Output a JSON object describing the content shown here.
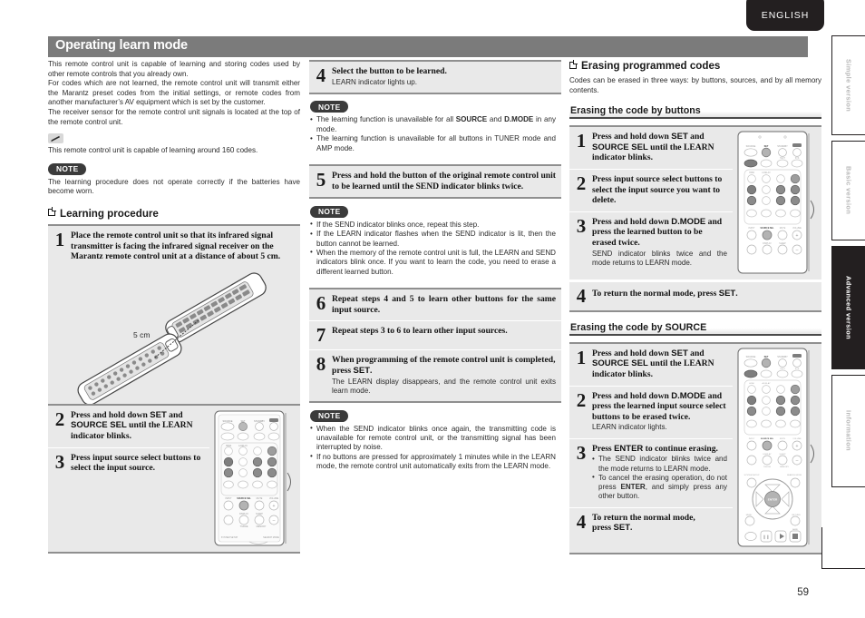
{
  "header": {
    "language_tab": "ENGLISH",
    "title": "Operating learn mode",
    "page_number": "59"
  },
  "side_tabs": [
    {
      "label": "Simple version",
      "active": false
    },
    {
      "label": "Basic version",
      "active": false
    },
    {
      "label": "Advanced version",
      "active": true
    },
    {
      "label": "Information",
      "active": false
    }
  ],
  "column1": {
    "intro_p1": "This remote control unit is capable of learning and storing codes used by other remote controls that you already own.",
    "intro_p2": "For codes which are not learned, the remote control unit will transmit either the Marantz preset codes from the initial settings, or remote codes from another manufacturer’s AV equipment which is set by the customer.",
    "intro_p3": "The receiver sensor for the remote control unit signals is located at the top of the remote control unit.",
    "tip_icon": "pencil-icon",
    "tip_text": "This remote control unit is capable of learning around 160 codes.",
    "note_label": "NOTE",
    "note_text": "The learning procedure does not operate correctly if the batteries have become worn.",
    "section_heading": "Learning procedure",
    "step1_num": "1",
    "step1_text": "Place the remote control unit so that its infrared signal transmitter is facing the infrared signal receiver on the Marantz remote control unit at a distance of about 5 cm.",
    "figure_label": "5 cm",
    "step2_num": "2",
    "step2_text_a": "Press and hold down ",
    "step2_bold1": "SET",
    "step2_text_b": " and ",
    "step2_bold2": "SOURCE SEL",
    "step2_text_c": " until the LEARN indicator blinks.",
    "step3_num": "3",
    "step3_text": "Press input source select buttons to select the input source."
  },
  "column2": {
    "step4_num": "4",
    "step4_lead": "Select the button to be learned.",
    "step4_desc": "LEARN indicator lights up.",
    "note1_label": "NOTE",
    "note1_items": [
      "The learning function is unavailable for all SOURCE and D.MODE in any mode.",
      "The learning function is unavailable for all buttons in TUNER mode and AMP mode."
    ],
    "step5_num": "5",
    "step5_lead": "Press and hold the button of the original remote control unit to be learned  until the SEND indicator blinks twice.",
    "note2_label": "NOTE",
    "note2_items": [
      "If the SEND indicator blinks once, repeat this step.",
      "If the LEARN indicator flashes when the SEND indicator is lit, then the button cannot be learned.",
      "When the memory of the remote control unit is full, the LEARN and SEND indicators blink once. If you want to learn the code, you need to erase a different learned button."
    ],
    "step6_num": "6",
    "step6_lead": "Repeat steps 4 and 5 to learn other buttons for the same input source.",
    "step7_num": "7",
    "step7_lead": "Repeat steps 3 to 6 to learn other input sources.",
    "step8_num": "8",
    "step8_lead": "When programming of the remote control unit is completed, press SET.",
    "step8_desc": "The LEARN display disappears, and the remote control unit exits learn mode.",
    "note3_label": "NOTE",
    "note3_items": [
      "When the SEND indicator blinks once again, the transmitting code is unavailable for remote control unit, or the transmitting signal has been interrupted by noise.",
      "If no buttons are pressed for approximately 1 minutes while in the LEARN mode, the remote control unit automatically exits from the LEARN mode."
    ]
  },
  "column3": {
    "section_heading": "Erasing programmed codes",
    "section_intro": "Codes can be erased in three ways: by buttons, sources, and by all memory contents.",
    "sub1_heading": "Erasing the code by buttons",
    "b_step1_num": "1",
    "b_step1_text": "Press and hold down SET and SOURCE SEL until the LEARN indicator blinks.",
    "b_step2_num": "2",
    "b_step2_text": "Press input source select buttons to select the input source you want to delete.",
    "b_step3_num": "3",
    "b_step3_text": "Press and hold down D.MODE and press the learned button to be erased twice.",
    "b_step3_desc": "SEND indicator blinks twice and the mode returns to LEARN mode.",
    "b_step4_num": "4",
    "b_step4_text": "To return the normal mode, press SET.",
    "sub2_heading": "Erasing the code by SOURCE",
    "s_step1_num": "1",
    "s_step1_text": "Press and hold down SET and SOURCE SEL until the LEARN indicator blinks.",
    "s_step2_num": "2",
    "s_step2_text": "Press and hold down D.MODE and press the learned input source select buttons to be erased twice.",
    "s_step2_desc": "LEARN indicator lights.",
    "s_step3_num": "3",
    "s_step3_text": "Press ENTER to continue erasing.",
    "s_step3_items": [
      "The SEND indicator blinks twice and the mode returns to LEARN mode.",
      "To cancel the erasing operation, do not press ENTER, and simply press any other button."
    ],
    "s_step4_num": "4",
    "s_step4_text": "To return the normal mode, press SET."
  },
  "remote_labels": {
    "row_top": [
      "SOURCE",
      "SET",
      "STANDBY",
      "VCR"
    ],
    "keys": [
      "DVD",
      "VCR",
      "SAT",
      "AUX",
      "TV",
      "CD",
      "AMP",
      "ENTER",
      "SOURCE SEL"
    ],
    "enter": "ENTER"
  },
  "colors": {
    "title_bar": "#7b7b7b",
    "box_bg": "#e9e9e9",
    "dark": "#231f20",
    "rule": "#8f8f8f"
  }
}
